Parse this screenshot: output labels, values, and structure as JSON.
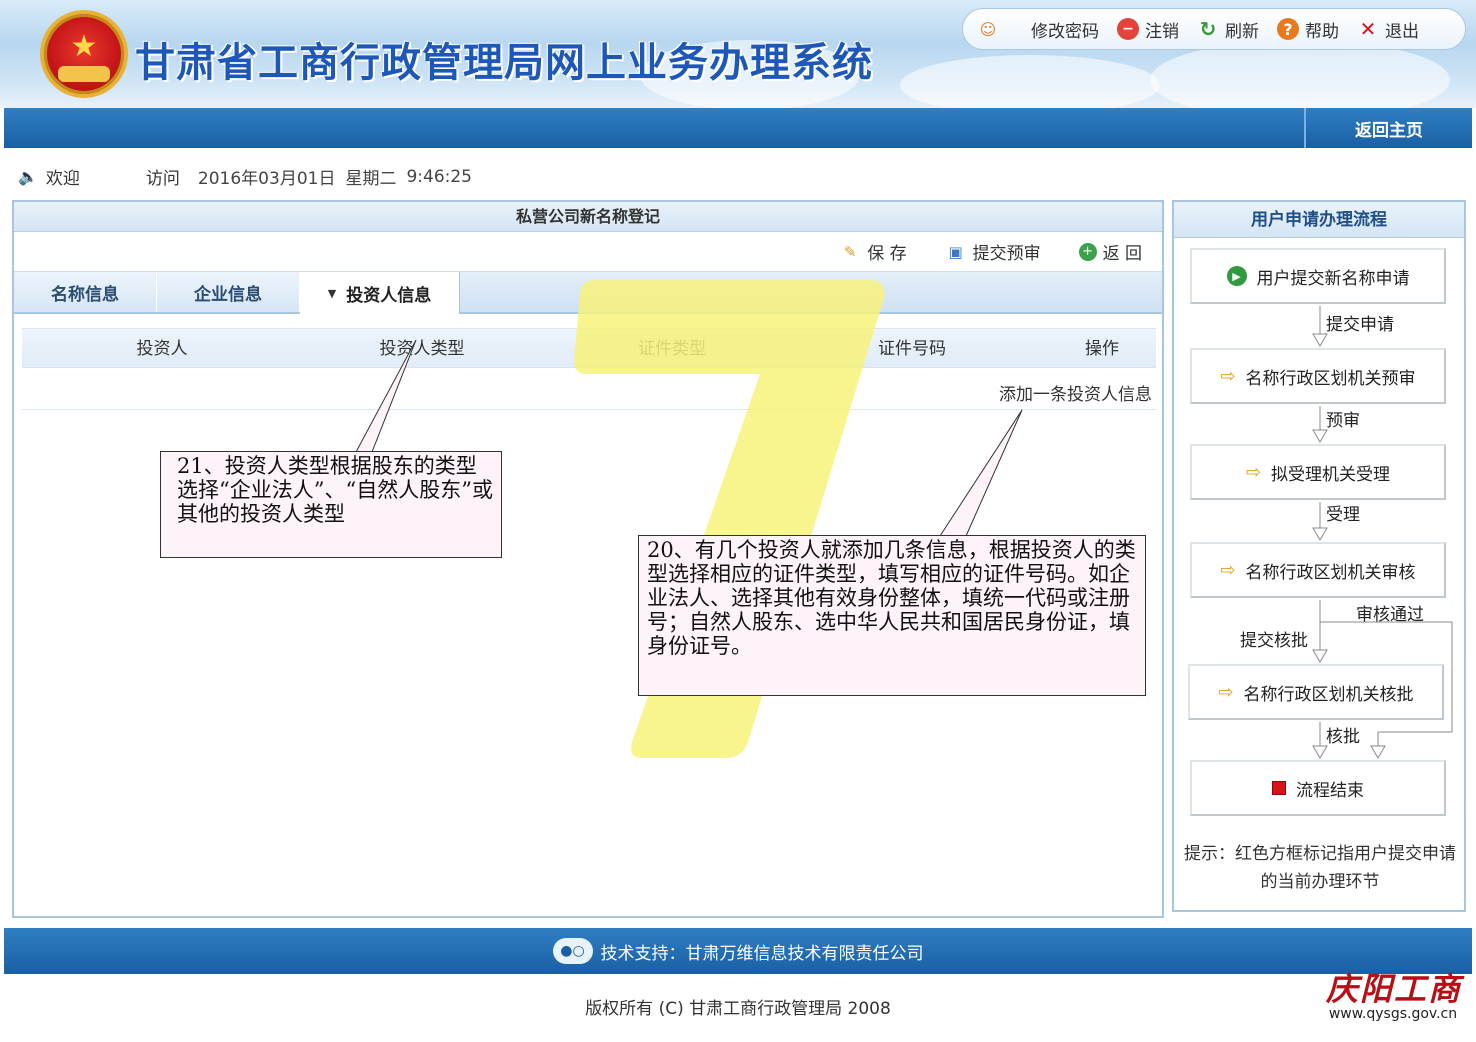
{
  "header": {
    "app_title": "甘肃省工商行政管理局网上业务办理系统",
    "toolbar": {
      "change_password": "修改密码",
      "logout": "注销",
      "refresh": "刷新",
      "help": "帮助",
      "exit": "退出"
    },
    "home_button": "返回主页"
  },
  "welcome": {
    "welcome_label": "欢迎",
    "visit_label": "访问",
    "date": "2016年03月01日",
    "weekday": "星期二",
    "time": "9:46:25"
  },
  "main": {
    "panel_title": "私营公司新名称登记",
    "actions": {
      "save": "保 存",
      "submit_precheck": "提交预审",
      "back": "返 回"
    },
    "tabs": [
      {
        "label": "名称信息"
      },
      {
        "label": "企业信息"
      },
      {
        "label": "投资人信息"
      }
    ],
    "grid": {
      "columns": [
        "投资人",
        "投资人类型",
        "证件类型",
        "证件号码",
        "操作"
      ],
      "add_link": "添加一条投资人信息"
    },
    "watermark_number": "7",
    "callouts": {
      "note21": "21、投资人类型根据股东的类型选择“企业法人”、“自然人股东”或其他的投资人类型",
      "note20": "20、有几个投资人就添加几条信息，根据投资人的类型选择相应的证件类型，填写相应的证件号码。如企业法人、选择其他有效身份整体，填统一代码或注册号；自然人股东、选中华人民共和国居民身份证，填身份证号。"
    }
  },
  "flow": {
    "title": "用户申请办理流程",
    "steps": [
      {
        "label": "用户提交新名称申请"
      },
      {
        "label": "名称行政区划机关预审"
      },
      {
        "label": "拟受理机关受理"
      },
      {
        "label": "名称行政区划机关审核"
      },
      {
        "label": "名称行政区划机关核批"
      },
      {
        "label": "流程结束"
      }
    ],
    "arrow_labels": {
      "submit_application": "提交申请",
      "precheck": "预审",
      "accept": "受理",
      "review_passed": "审核通过",
      "submit_approval": "提交核批",
      "approve": "核批"
    },
    "hint": "提示：红色方框标记指用户提交申请的当前办理环节"
  },
  "footer": {
    "tech_support": "技术支持：甘肃万维信息技术有限责任公司",
    "copyright": "版权所有 (C) 甘肃工商行政管理局 2008"
  },
  "watermark": {
    "logo_text": "庆阳工商",
    "url": "www.qysgs.gov.cn"
  },
  "colors": {
    "nav_blue": "#1f6cb3",
    "title_blue": "#1d58b8",
    "callout_bg": "#fff3fa",
    "highlight_yellow": "#f7f27a",
    "end_red": "#d8141a"
  }
}
